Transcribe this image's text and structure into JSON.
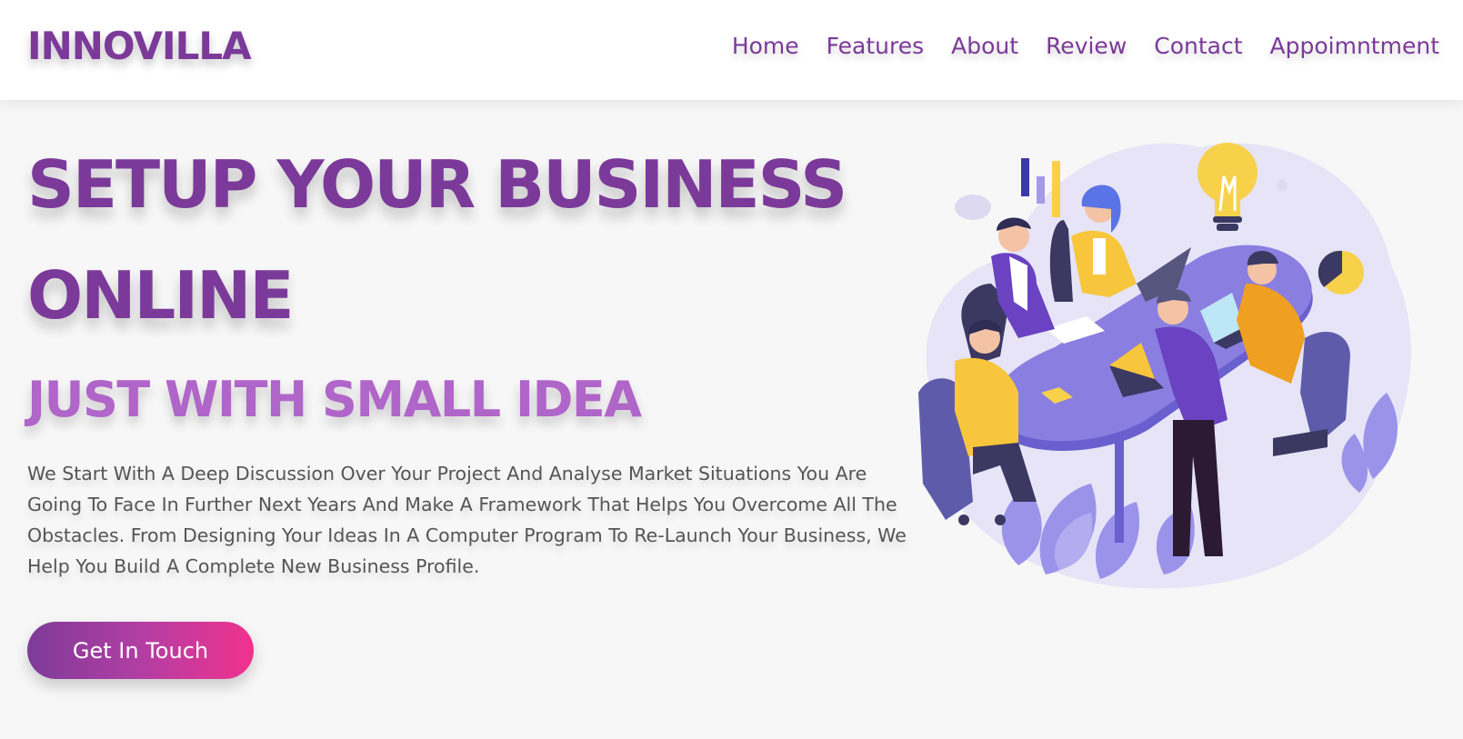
{
  "brand": {
    "name": "INNOVILLA"
  },
  "nav": {
    "items": [
      {
        "label": "Home"
      },
      {
        "label": "Features"
      },
      {
        "label": "About"
      },
      {
        "label": "Review"
      },
      {
        "label": "Contact"
      },
      {
        "label": "Appoimntment"
      }
    ]
  },
  "hero": {
    "title": "SETUP YOUR BUSINESS ONLINE",
    "subtitle": "JUST WITH SMALL IDEA",
    "description": "We Start With A Deep Discussion Over Your Project And Analyse Market Situations You Are Going To Face In Further Next Years And Make A Framework That Helps You Overcome All The Obstacles. From Designing Your Ideas In A Computer Program To Re-Launch Your Business, We Help You Build A Complete New Business Profile.",
    "cta_label": "Get In Touch",
    "illustration": "team-meeting-illustration"
  },
  "colors": {
    "brand_purple": "#7b3a99",
    "subtitle_purple": "#b065c9",
    "gradient_start": "#7e3b98",
    "gradient_end": "#f1328d",
    "background": "#f7f7f7"
  }
}
